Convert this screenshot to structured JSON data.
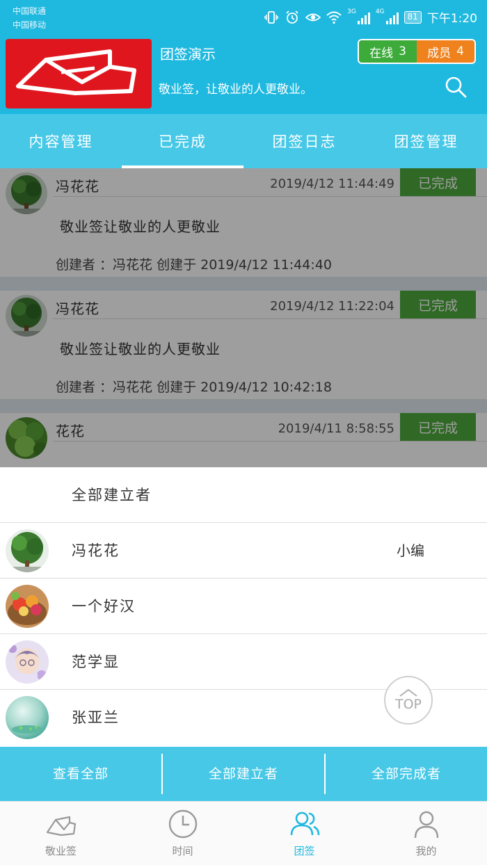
{
  "status_bar": {
    "carrier_1": "中国联通",
    "carrier_2": "中国移动",
    "network_3g": "3G",
    "network_4g": "4G",
    "battery": "81",
    "time": "下午1:20"
  },
  "header": {
    "title": "团签演示",
    "description": "敬业签，让敬业的人更敬业。",
    "online_label": "在线",
    "online_count": "3",
    "member_label": "成员",
    "member_count": "4",
    "brand_color": "#1fb9e0"
  },
  "tabs": [
    {
      "label": "内容管理"
    },
    {
      "label": "已完成"
    },
    {
      "label": "团签日志"
    },
    {
      "label": "团签管理"
    }
  ],
  "items": [
    {
      "name": "冯花花",
      "time": "2019/4/12  11:44:49",
      "status": "已完成",
      "content": "敬业签让敬业的人更敬业",
      "meta": "创建者 ：冯花花 创建于 2019/4/12  11:44:40"
    },
    {
      "name": "冯花花",
      "time": "2019/4/12  11:22:04",
      "status": "已完成",
      "content": "敬业签让敬业的人更敬业",
      "meta": "创建者 ：冯花花 创建于 2019/4/12  10:42:18"
    },
    {
      "name": "花花",
      "time": "2019/4/11  8:58:55",
      "status": "已完成",
      "content": "",
      "meta": ""
    }
  ],
  "sheet": {
    "all_label": "全部建立者",
    "members": [
      {
        "name": "冯花花",
        "role": "小编"
      },
      {
        "name": "一个好汉",
        "role": ""
      },
      {
        "name": "范学显",
        "role": ""
      },
      {
        "name": "张亚兰",
        "role": ""
      }
    ]
  },
  "top_button": "TOP",
  "actions": [
    {
      "label": "查看全部"
    },
    {
      "label": "全部建立者"
    },
    {
      "label": "全部完成者"
    }
  ],
  "nav": [
    {
      "label": "敬业签",
      "icon": "notes-icon"
    },
    {
      "label": "时间",
      "icon": "clock-icon"
    },
    {
      "label": "团签",
      "icon": "team-icon"
    },
    {
      "label": "我的",
      "icon": "profile-icon"
    }
  ]
}
